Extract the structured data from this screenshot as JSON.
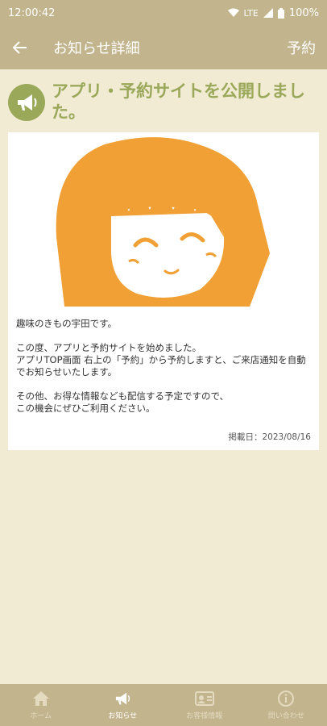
{
  "status_bar": {
    "time": "12:00:42",
    "network": "LTE",
    "battery": "100%"
  },
  "app_bar": {
    "title": "お知らせ詳細",
    "reserve_label": "予約"
  },
  "notice": {
    "headline": "アプリ・予約サイトを公開しました。",
    "body": "趣味のきもの宇田です。\n\nこの度、アプリと予約サイトを始めました。\nアプリTOP画面 右上の「予約」から予約しますと、ご来店通知を自動でお知らせいたします。\n\nその他、お得な情報なども配信する予定ですので、\nこの機会にぜひご利用ください。",
    "posted_label": "掲載日：2023/08/16"
  },
  "bottom_nav": {
    "items": [
      {
        "label": "ホーム",
        "icon": "home-icon"
      },
      {
        "label": "お知らせ",
        "icon": "megaphone-icon"
      },
      {
        "label": "お客様情報",
        "icon": "id-card-icon"
      },
      {
        "label": "問い合わせ",
        "icon": "info-icon"
      }
    ],
    "active_index": 1
  },
  "colors": {
    "app_bar": "#c2b48c",
    "background": "#f1ebd3",
    "accent_green": "#9aa85a",
    "illustration_orange": "#f0a034"
  }
}
